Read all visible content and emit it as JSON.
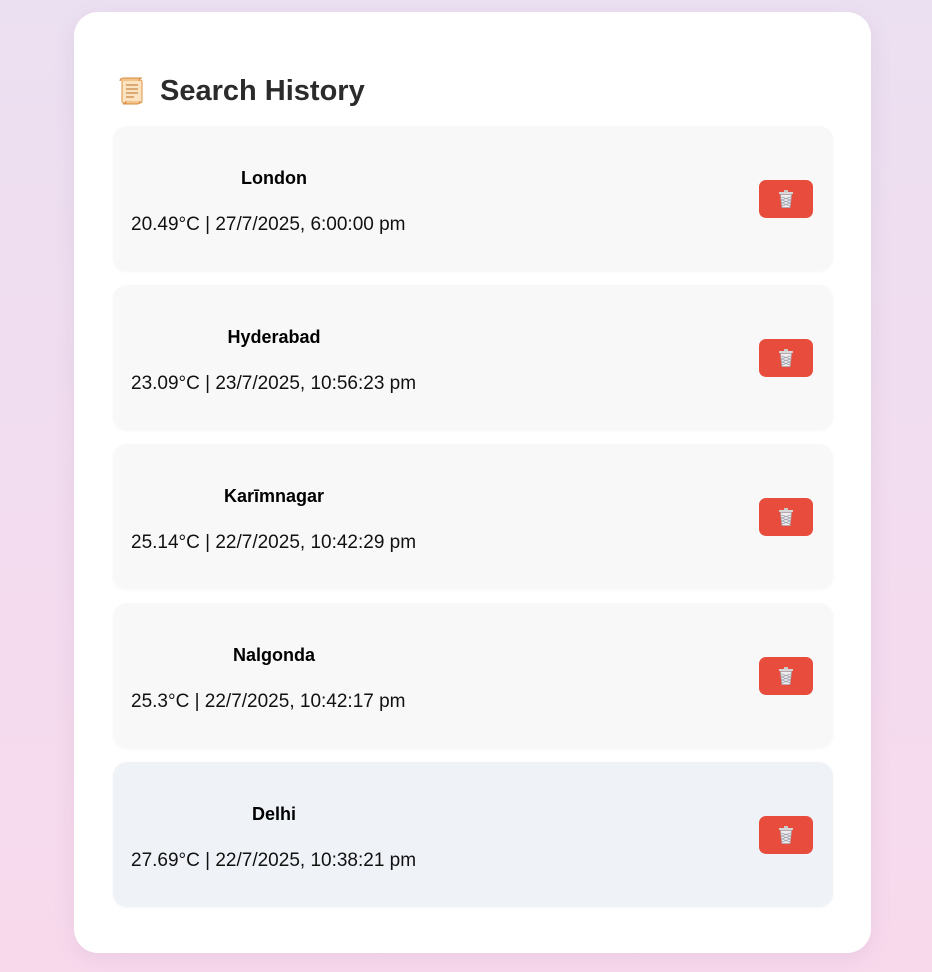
{
  "history": {
    "title": "Search History",
    "title_icon": "scroll-icon",
    "items": [
      {
        "city": "London",
        "meta": "20.49°C | 27/7/2025, 6:00:00 pm",
        "delete_icon": "trash-icon"
      },
      {
        "city": "Hyderabad",
        "meta": "23.09°C | 23/7/2025, 10:56:23 pm",
        "delete_icon": "trash-icon"
      },
      {
        "city": "Karīmnagar",
        "meta": "25.14°C | 22/7/2025, 10:42:29 pm",
        "delete_icon": "trash-icon"
      },
      {
        "city": "Nalgonda",
        "meta": "25.3°C | 22/7/2025, 10:42:17 pm",
        "delete_icon": "trash-icon"
      },
      {
        "city": "Delhi",
        "meta": "27.69°C | 22/7/2025, 10:38:21 pm",
        "delete_icon": "trash-icon"
      }
    ]
  },
  "colors": {
    "delete_button": "#e74c3c",
    "item_background": "#f8f8f8",
    "item_hover_background": "#eff2f7"
  }
}
